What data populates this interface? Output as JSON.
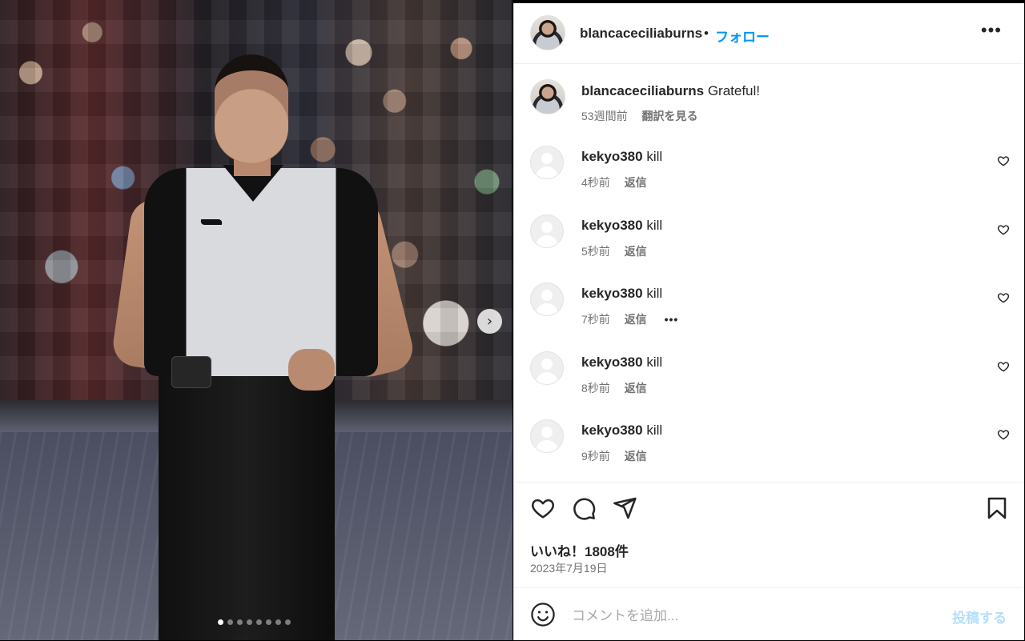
{
  "post": {
    "username": "blancaceciliaburns",
    "bullet": "•",
    "follow_label": "フォロー",
    "more_label": "•••"
  },
  "caption": {
    "username": "blancaceciliaburns",
    "text": "Grateful!",
    "time": "53週間前",
    "translate_label": "翻訳を見る"
  },
  "comments": [
    {
      "username": "kekyo380",
      "text": "kill",
      "time": "4秒前",
      "reply_label": "返信",
      "show_more": false
    },
    {
      "username": "kekyo380",
      "text": "kill",
      "time": "5秒前",
      "reply_label": "返信",
      "show_more": false
    },
    {
      "username": "kekyo380",
      "text": "kill",
      "time": "7秒前",
      "reply_label": "返信",
      "show_more": true,
      "more_label": "•••"
    },
    {
      "username": "kekyo380",
      "text": "kill",
      "time": "8秒前",
      "reply_label": "返信",
      "show_more": false
    },
    {
      "username": "kekyo380",
      "text": "kill",
      "time": "9秒前",
      "reply_label": "返信",
      "show_more": false
    }
  ],
  "stats": {
    "likes": "いいね！1808件",
    "date": "2023年7月19日"
  },
  "comment_input": {
    "placeholder": "コメントを追加...",
    "post_label": "投稿する"
  },
  "carousel": {
    "next_label": "›",
    "total_slides": 8,
    "current_slide": 1
  },
  "icons": {
    "like": "heart-icon",
    "comment": "comment-bubble-icon",
    "share": "send-icon",
    "save": "bookmark-icon",
    "emoji": "smiley-icon"
  },
  "colors": {
    "link_blue": "#0095f6",
    "post_disabled": "#b2dffc",
    "muted_text": "#737373"
  }
}
